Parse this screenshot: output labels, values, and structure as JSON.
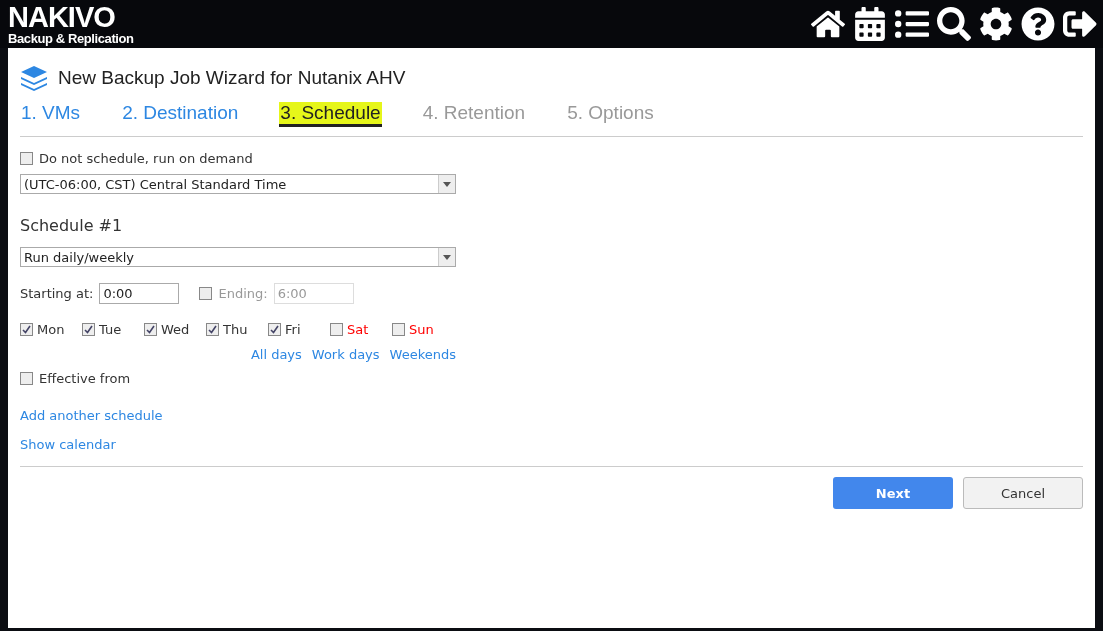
{
  "brand": {
    "name": "NAKIVO",
    "subtitle": "Backup & Replication"
  },
  "wizard": {
    "title": "New Backup Job Wizard for Nutanix AHV"
  },
  "steps": [
    {
      "label": "1. VMs",
      "selected": false,
      "disabled": false
    },
    {
      "label": "2. Destination",
      "selected": false,
      "disabled": false
    },
    {
      "label": "3. Schedule",
      "selected": true,
      "disabled": false
    },
    {
      "label": "4. Retention",
      "selected": false,
      "disabled": true
    },
    {
      "label": "5. Options",
      "selected": false,
      "disabled": true
    }
  ],
  "on_demand": {
    "label": "Do not schedule, run on demand",
    "checked": false
  },
  "timezone": {
    "value": "(UTC-06:00, CST) Central Standard Time"
  },
  "schedule": {
    "heading": "Schedule #1",
    "type": "Run daily/weekly",
    "starting_label": "Starting at:",
    "starting_value": "0:00",
    "ending_checked": false,
    "ending_label": "Ending:",
    "ending_value": "6:00",
    "ending_disabled": true,
    "days": [
      {
        "label": "Mon",
        "checked": true,
        "color": "#333333"
      },
      {
        "label": "Tue",
        "checked": true,
        "color": "#333333"
      },
      {
        "label": "Wed",
        "checked": true,
        "color": "#333333"
      },
      {
        "label": "Thu",
        "checked": true,
        "color": "#333333"
      },
      {
        "label": "Fri",
        "checked": true,
        "color": "#333333"
      },
      {
        "label": "Sat",
        "checked": false,
        "color": "#ff0000"
      },
      {
        "label": "Sun",
        "checked": false,
        "color": "#ff0000"
      }
    ],
    "day_links": [
      "All days",
      "Work days",
      "Weekends"
    ],
    "effective_from": {
      "label": "Effective from",
      "checked": false
    }
  },
  "links": [
    "Add another schedule",
    "Show calendar"
  ],
  "buttons": {
    "next": "Next",
    "cancel": "Cancel"
  }
}
